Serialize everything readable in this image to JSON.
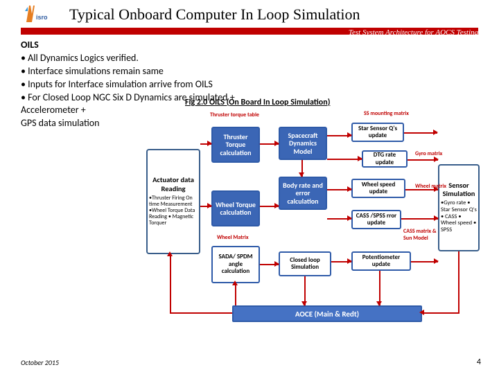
{
  "title": "Typical Onboard Computer In Loop Simulation",
  "subtitle": "Test System Architecture for AOCS Testing",
  "oils": {
    "heading": "OILS",
    "b1": "• All Dynamics Logics verified.",
    "b2": "• Interface simulations remain same",
    "b3": "• Inputs for Interface simulation arrive from OILS",
    "b4": "• For Closed Loop NGC Six D Dynamics are simulated + Accelerometer +",
    "b5": " GPS data simulation"
  },
  "fig_caption": "Fig 2.0 OILS (On Board In Loop Simulation)",
  "labels": {
    "thruster_table": "Thruster torque table",
    "ss_matrix": "SS mounting matrix",
    "gyro_matrix": "Gyro matrix",
    "wheel_matrix": "Wheel matrix",
    "cass_sun": "CASS matrix & Sun Model",
    "wheel_small": "Wheel Matrix"
  },
  "boxes": {
    "actuator": {
      "hdr": "Actuator data Reading",
      "body": "•Thruster Firing On time Measurement •Wheel Torque Data Reading • Magnetic Torquer"
    },
    "sensor": {
      "hdr": "Sensor Simulation",
      "body": "•Gyro rate • Star Sensor Q's • CASS • Wheel speed • SPSS"
    },
    "thruster_calc": "Thruster Torque calculation",
    "wheel_calc": "Wheel Torque calculation",
    "sada": "SADA/ SPDM angle calculation",
    "sdm": "Spacecraft Dynamics Model",
    "bodyrate": "Body rate and error calculation",
    "closedloop": "Closed loop Simulation",
    "ssq": "Star Sensor Q's update",
    "dtg": "DTG rate update",
    "wheelspd": "Wheel speed update",
    "cass": "CASS /SPSS rror update",
    "pot": "Potentiometer update",
    "aoce": "AOCE (Main & Redt)"
  },
  "footer": {
    "date": "October 2015",
    "page": "4"
  }
}
